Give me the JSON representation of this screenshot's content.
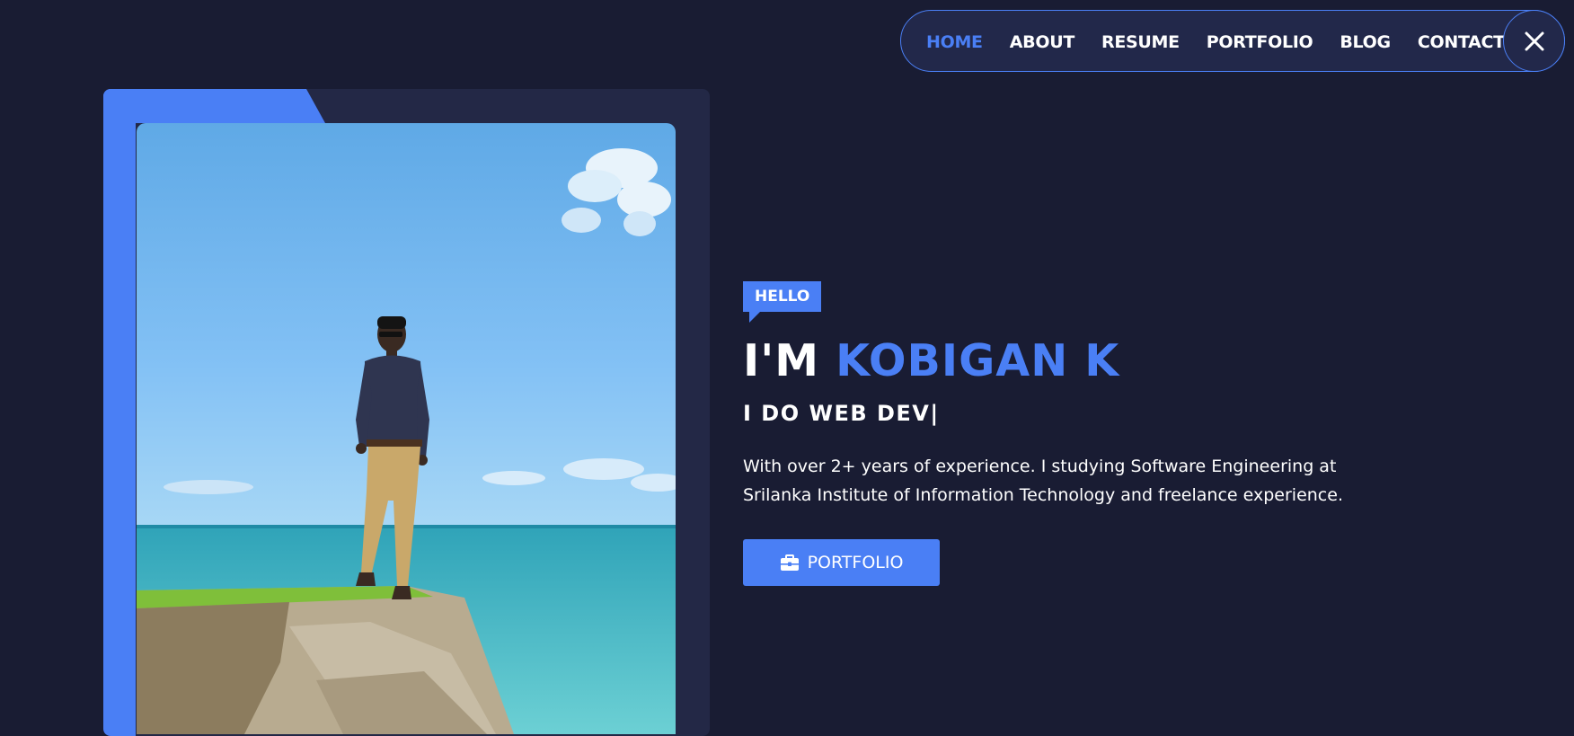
{
  "nav": {
    "items": [
      {
        "label": "HOME",
        "active": true
      },
      {
        "label": "ABOUT",
        "active": false
      },
      {
        "label": "RESUME",
        "active": false
      },
      {
        "label": "PORTFOLIO",
        "active": false
      },
      {
        "label": "BLOG",
        "active": false
      },
      {
        "label": "CONTACT",
        "active": false
      }
    ],
    "close_icon": "close-icon"
  },
  "hero": {
    "badge": "HELLO",
    "title_prefix": "I'M",
    "title_name": "KOBIGAN K",
    "tagline": "I DO WEB DEV|",
    "bio_line1": "With over 2+ years of experience. I studying Software Engineering at",
    "bio_line2": "Srilanka Institute of Information Technology and freelance experience.",
    "cta_label": "PORTFOLIO",
    "cta_icon": "briefcase-icon"
  },
  "colors": {
    "background": "#191c33",
    "accent": "#4a7ff5",
    "card": "#232846",
    "text": "#ffffff"
  }
}
